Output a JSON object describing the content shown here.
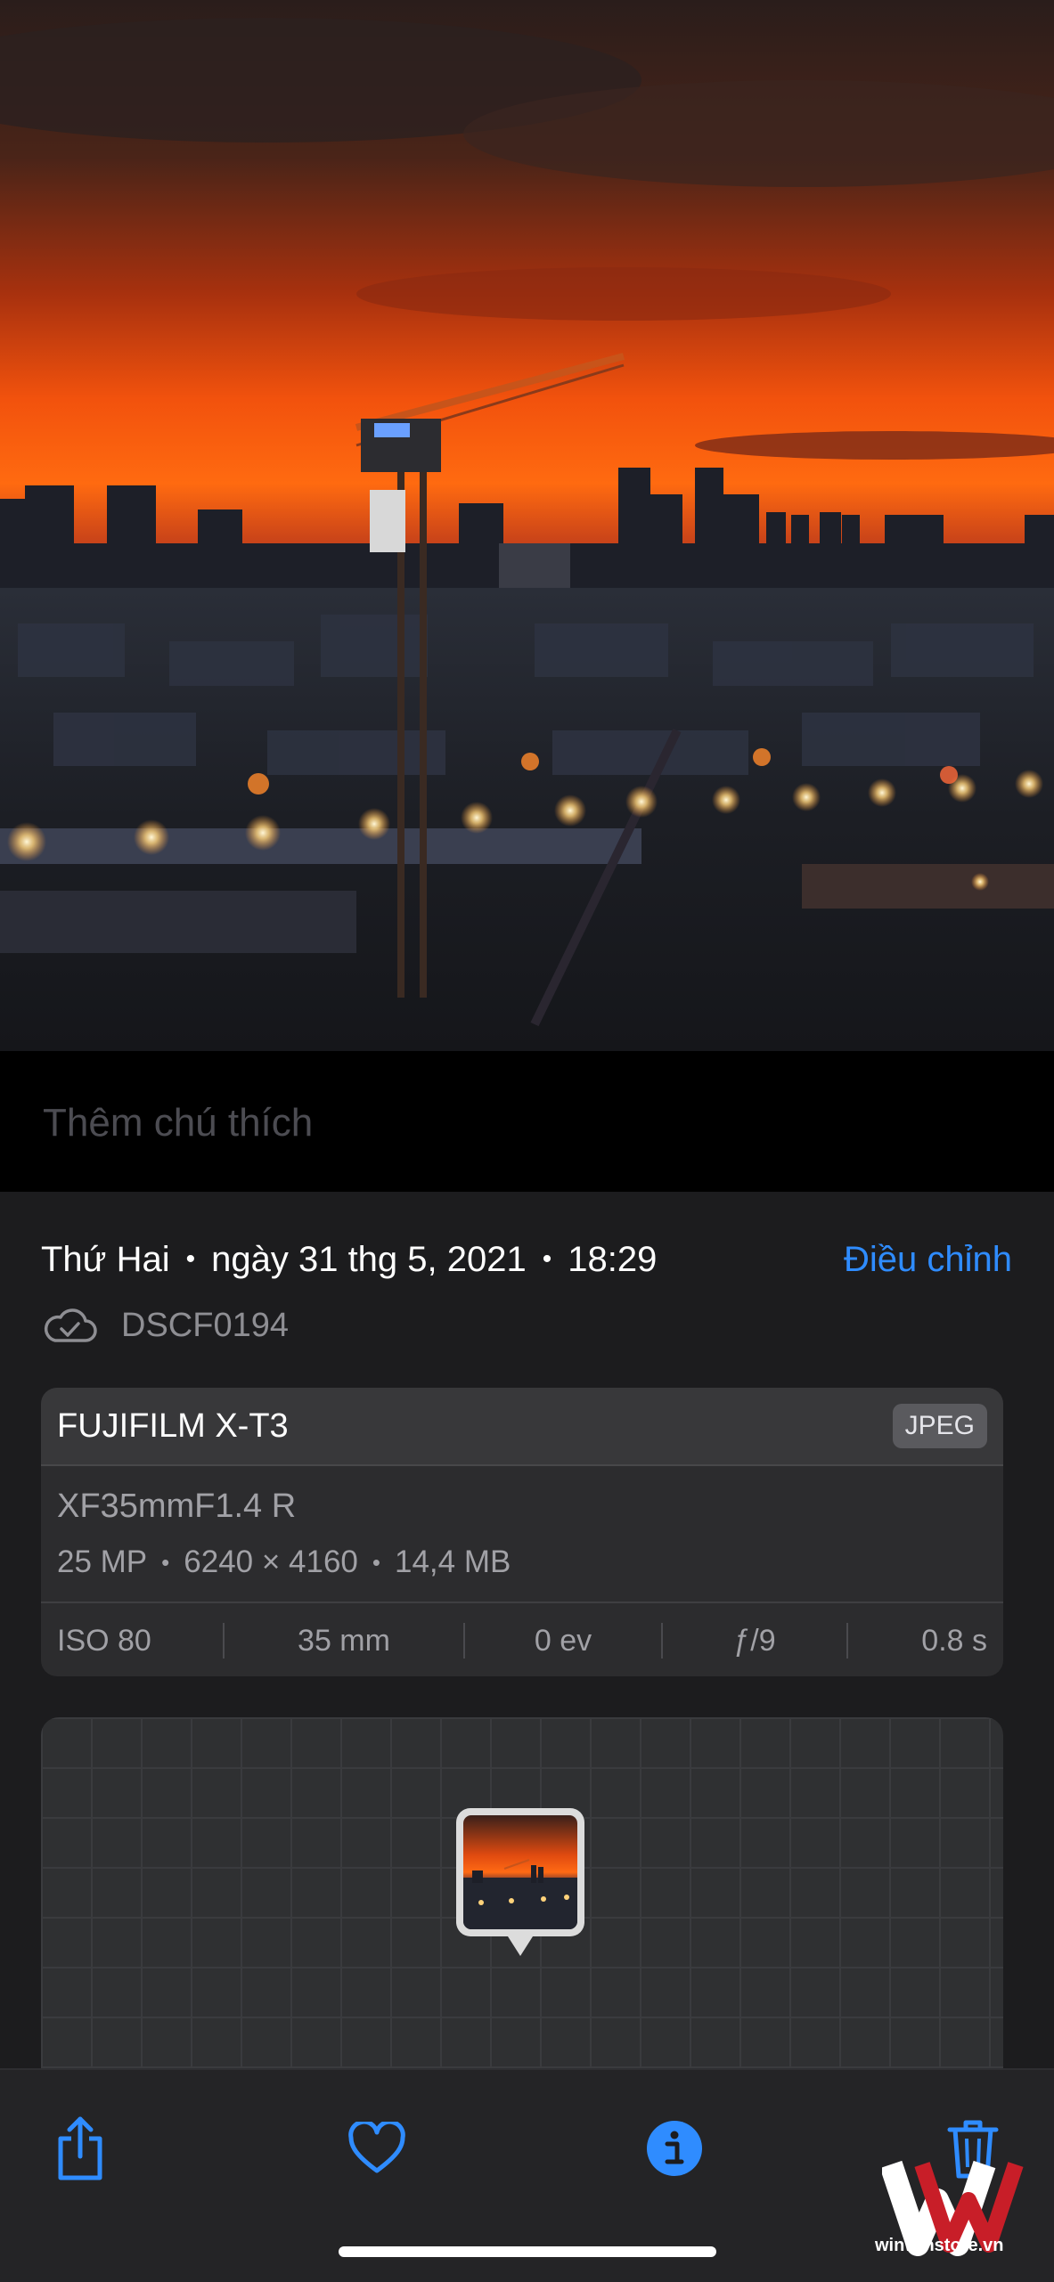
{
  "photo": {
    "subject": "city skyline at sunset with construction crane"
  },
  "caption": {
    "placeholder": "Thêm chú thích"
  },
  "info": {
    "day": "Thứ Hai",
    "date": "ngày 31 thg 5, 2021",
    "time": "18:29",
    "separator": "•",
    "adjust_label": "Điều chỉnh",
    "file_name": "DSCF0194",
    "cloud_icon": "icloud-synced-icon"
  },
  "camera": {
    "model": "FUJIFILM X-T3",
    "format": "JPEG",
    "lens": "XF35mmF1.4 R",
    "megapixels": "25 MP",
    "resolution": "6240 × 4160",
    "file_size": "14,4 MB",
    "exif": {
      "iso": "ISO 80",
      "focal_length": "35 mm",
      "exposure_bias": "0 ev",
      "aperture": "ƒ/9",
      "shutter": "0.8 s"
    }
  },
  "toolbar": {
    "share_icon": "share-icon",
    "favorite_icon": "heart-icon",
    "info_icon": "info-icon",
    "delete_icon": "trash-icon"
  },
  "watermark": {
    "text": "winwinstore.vn"
  },
  "colors": {
    "accent": "#2f8cff",
    "panel": "#1c1c1e",
    "card": "#2c2c2e"
  }
}
